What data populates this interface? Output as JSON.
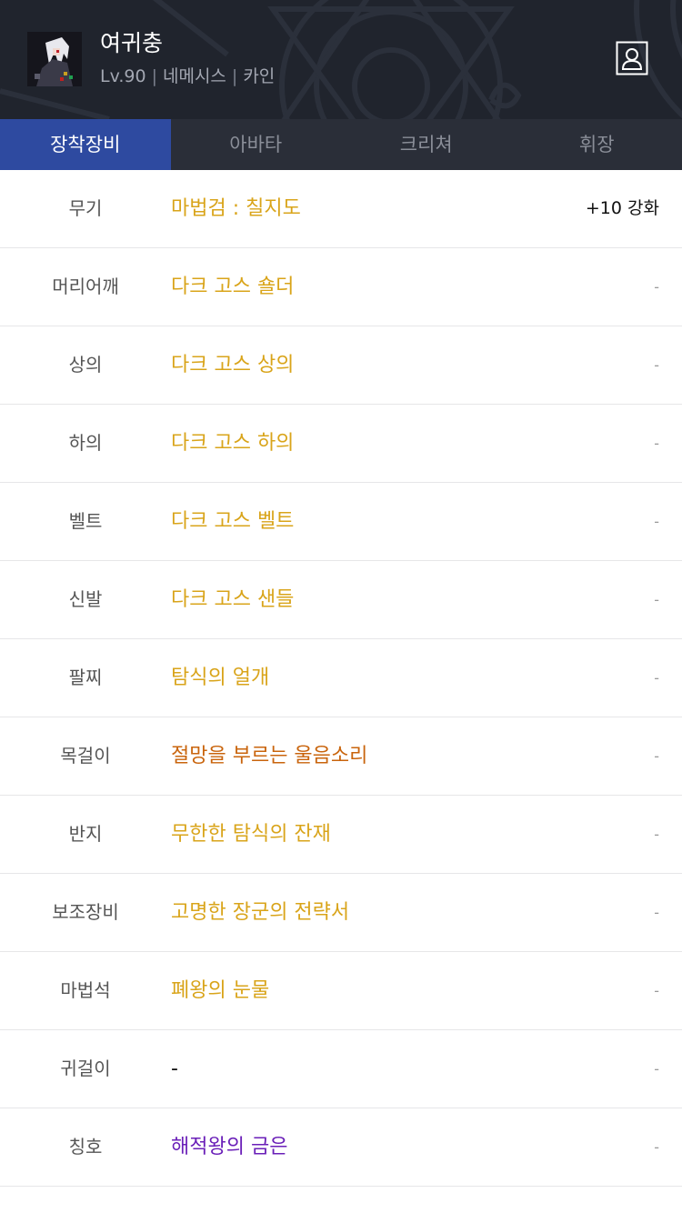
{
  "header": {
    "avatar_icon": "character-portrait",
    "name": "여귀충",
    "level": "Lv.90",
    "server": "네메시스",
    "job": "카인",
    "profile_icon": "profile-icon"
  },
  "tabs": [
    {
      "label": "장착장비",
      "active": true
    },
    {
      "label": "아바타",
      "active": false
    },
    {
      "label": "크리쳐",
      "active": false
    },
    {
      "label": "휘장",
      "active": false
    }
  ],
  "colors": {
    "unique": "#d9a41a",
    "legendary": "#c9640c",
    "epic": "#6a1fb8",
    "none": "#111111",
    "tab_active": "#2e4aa0"
  },
  "equipment": [
    {
      "slot": "무기",
      "item": "마법검 : 칠지도",
      "color": "#d9a41a",
      "enhance": "+10 강화"
    },
    {
      "slot": "머리어깨",
      "item": "다크 고스 숄더",
      "color": "#d9a41a",
      "enhance": "-"
    },
    {
      "slot": "상의",
      "item": "다크 고스 상의",
      "color": "#d9a41a",
      "enhance": "-"
    },
    {
      "slot": "하의",
      "item": "다크 고스 하의",
      "color": "#d9a41a",
      "enhance": "-"
    },
    {
      "slot": "벨트",
      "item": "다크 고스 벨트",
      "color": "#d9a41a",
      "enhance": "-"
    },
    {
      "slot": "신발",
      "item": "다크 고스 샌들",
      "color": "#d9a41a",
      "enhance": "-"
    },
    {
      "slot": "팔찌",
      "item": "탐식의 얼개",
      "color": "#d9a41a",
      "enhance": "-"
    },
    {
      "slot": "목걸이",
      "item": "절망을 부르는 울음소리",
      "color": "#c9640c",
      "enhance": "-"
    },
    {
      "slot": "반지",
      "item": "무한한 탐식의 잔재",
      "color": "#d9a41a",
      "enhance": "-"
    },
    {
      "slot": "보조장비",
      "item": "고명한 장군의 전략서",
      "color": "#d9a41a",
      "enhance": "-"
    },
    {
      "slot": "마법석",
      "item": "폐왕의 눈물",
      "color": "#d9a41a",
      "enhance": "-"
    },
    {
      "slot": "귀걸이",
      "item": "-",
      "color": "#111111",
      "enhance": "-"
    },
    {
      "slot": "칭호",
      "item": "해적왕의 금은",
      "color": "#6a1fb8",
      "enhance": "-"
    }
  ]
}
